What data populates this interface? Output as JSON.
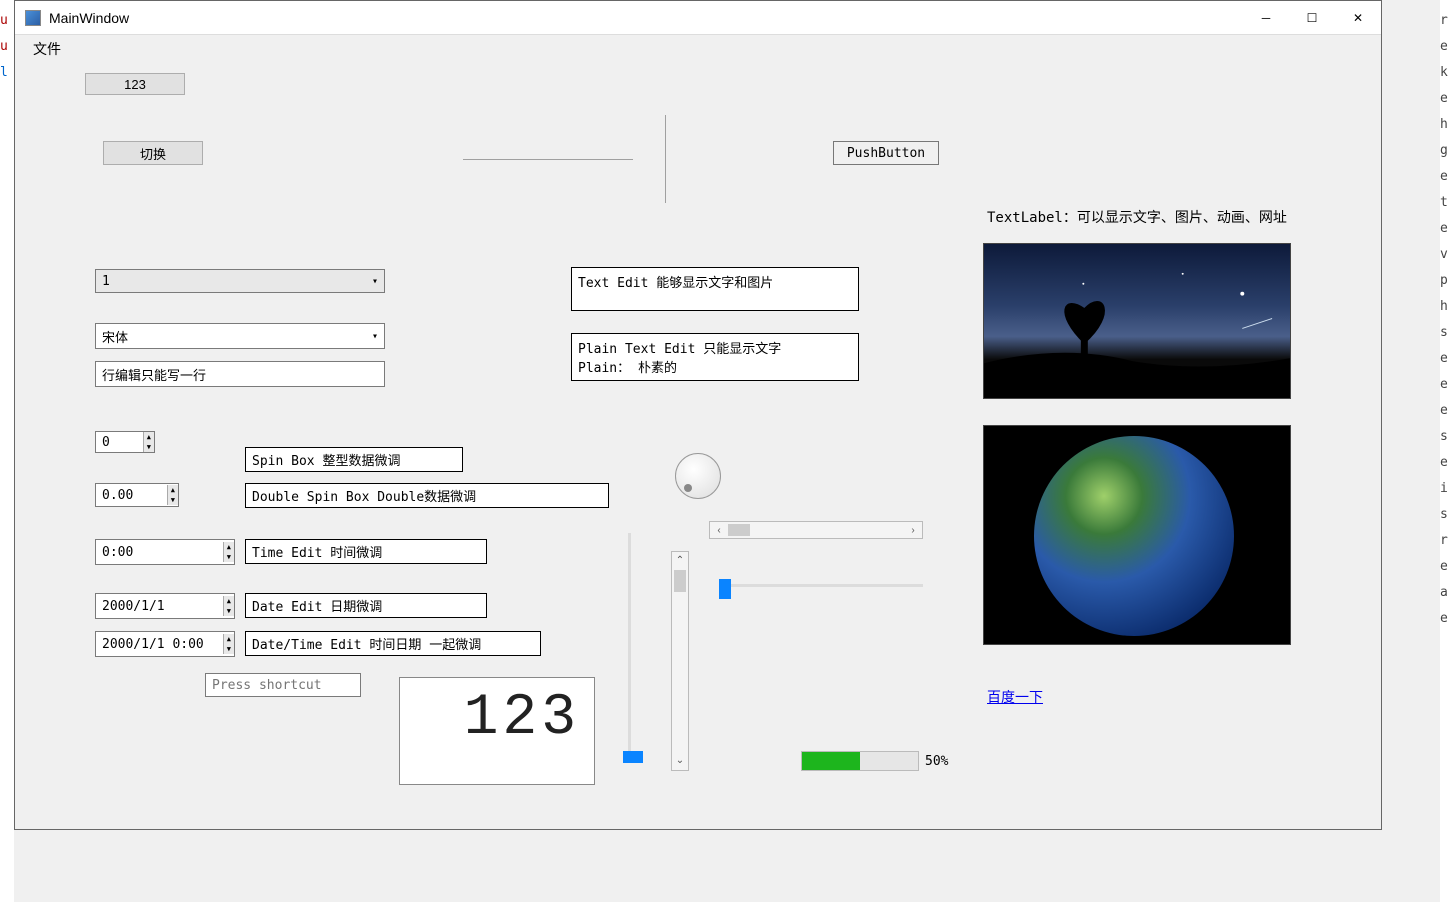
{
  "window": {
    "title": "MainWindow"
  },
  "menubar": {
    "file": "文件"
  },
  "btn123": "123",
  "switch_btn": "切换",
  "push_btn": "PushButton",
  "combo_number": "1",
  "font_combo": "宋体",
  "lineedit": "行编辑只能写一行",
  "spinbox": {
    "value": "0",
    "label": "Spin Box 整型数据微调"
  },
  "doublespin": {
    "value": "0.00",
    "label": "Double Spin Box Double数据微调"
  },
  "timeedit": {
    "value": "0:00",
    "label": "Time Edit 时间微调"
  },
  "dateedit": {
    "value": "2000/1/1",
    "label": "Date Edit 日期微调"
  },
  "datetimeedit": {
    "value": "2000/1/1 0:00",
    "label": "Date/Time Edit 时间日期 一起微调"
  },
  "shortcut_placeholder": "Press shortcut",
  "lcd": "123",
  "textedit": "Text Edit 能够显示文字和图片",
  "plaintextedit": "Plain Text Edit 只能显示文字\nPlain： 朴素的",
  "textlabel": "TextLabel：可以显示文字、图片、动画、网址",
  "link": "百度一下",
  "progress": {
    "percent": 50,
    "text": "50%"
  }
}
